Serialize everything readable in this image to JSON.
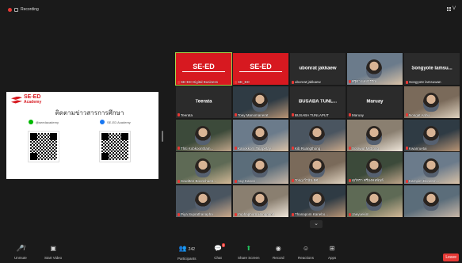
{
  "recording": {
    "label": "Recording"
  },
  "view_button": {
    "label": "V"
  },
  "shared": {
    "logo_line1": "SE-ED",
    "logo_line2": "Academy",
    "title": "ติดตามข่าวสารการศึกษา",
    "line_handle": "@seedacademy",
    "facebook_handle": "SE-ED Academy"
  },
  "participants": [
    {
      "name": "SE-ED Digital Business",
      "center": "SE-ED",
      "type": "logo",
      "active": true
    },
    {
      "name": "SE_ED",
      "center": "SE-ED",
      "type": "logo"
    },
    {
      "name": "ubonrat jakkaew",
      "center": "ubonrat jakkaew",
      "type": "name"
    },
    {
      "name": "ศรุตา แสงวรรณ",
      "type": "video"
    },
    {
      "name": "Songyote lamsuwan",
      "center": "Songyote lamsu...",
      "type": "name"
    },
    {
      "name": "Teerata",
      "center": "Teerata",
      "type": "name"
    },
    {
      "name": "Toey Manomanerat",
      "type": "video"
    },
    {
      "name": "BUSABA TUNLAPUT",
      "center": "BUSABA  TUNL...",
      "type": "name"
    },
    {
      "name": "Maruay",
      "center": "Maruay",
      "type": "name"
    },
    {
      "name": "Nongat Anhu",
      "type": "video"
    },
    {
      "name": "Thiti Kobkoontham...",
      "type": "video"
    },
    {
      "name": "Kanokkorn Talapetay",
      "type": "video"
    },
    {
      "name": "Kib Ruangthong",
      "type": "video"
    },
    {
      "name": "Sorawut Mittrong",
      "type": "video"
    },
    {
      "name": "Kwanruetai",
      "type": "video"
    },
    {
      "name": "Sowittee Boonchuen...",
      "type": "video"
    },
    {
      "name": "Auy Kanon",
      "type": "video"
    },
    {
      "name": "Tong กำนัน ยศ",
      "type": "video"
    },
    {
      "name": "สุภัทรา ศรีมงคลพันธ์",
      "type": "video"
    },
    {
      "name": "Karnpim Bondsm...",
      "type": "video"
    },
    {
      "name": "Piya Suprathanapha",
      "type": "video"
    },
    {
      "name": "Yuphaphorn Hongpanit",
      "type": "video"
    },
    {
      "name": "Thanapom Kanebo...",
      "type": "video"
    },
    {
      "name": "Jaeyuekim",
      "type": "video"
    },
    {
      "name": "",
      "type": "video"
    }
  ],
  "toolbar": {
    "unmute": "Unmute",
    "start_video": "Start Video",
    "participants": "Participants",
    "participants_count": "242",
    "chat": "Chat",
    "chat_badge": "2",
    "share_screen": "Share Screen",
    "record": "Record",
    "reactions": "Reactions",
    "apps": "Apps",
    "leave": "Leave"
  },
  "colors": {
    "brand": "#d71920",
    "active": "#a7d84a",
    "bg": "#1a1a1a",
    "tile": "#2b2b2b"
  }
}
